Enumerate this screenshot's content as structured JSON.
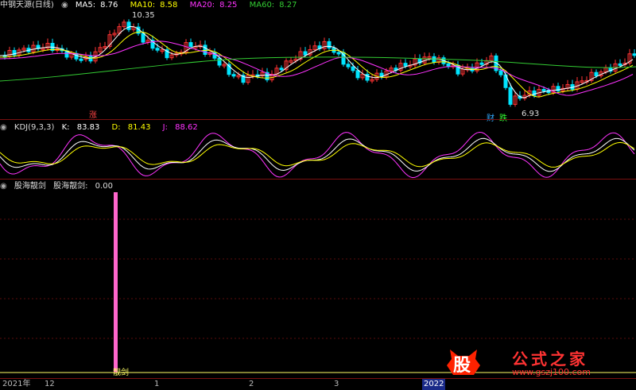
{
  "main": {
    "title": "中钢天源(日线)",
    "ma": [
      {
        "label": "MA5:",
        "value": "8.76",
        "color": "#ffffff"
      },
      {
        "label": "MA10:",
        "value": "8.58",
        "color": "#ffff00"
      },
      {
        "label": "MA20:",
        "value": "8.25",
        "color": "#ff33ff"
      },
      {
        "label": "MA60:",
        "value": "8.27",
        "color": "#33cc33"
      }
    ],
    "high_label": "10.35",
    "low_label": "6.93",
    "markers": {
      "zhang": "涨",
      "cai": "财",
      "die": "跌"
    }
  },
  "kdj": {
    "title": "KDJ(9,3,3)",
    "k_label": "K:",
    "k_value": "83.83",
    "d_label": "D:",
    "d_value": "81.43",
    "j_label": "J:",
    "j_value": "88.62"
  },
  "indicator": {
    "title": "股海靓剑",
    "series_label": "股海靓剑:",
    "series_value": "0.00",
    "signal_label": "靓剑"
  },
  "axis": {
    "labels": [
      "2021年",
      "12",
      "1",
      "2",
      "3",
      "2022"
    ]
  },
  "logo": {
    "char": "股",
    "text": "公式之家",
    "url": "www.gszj100.com"
  },
  "colors": {
    "up": "#ff3333",
    "down": "#00e5ff",
    "grid": "#7a1010",
    "pink": "#ff66cc"
  }
}
